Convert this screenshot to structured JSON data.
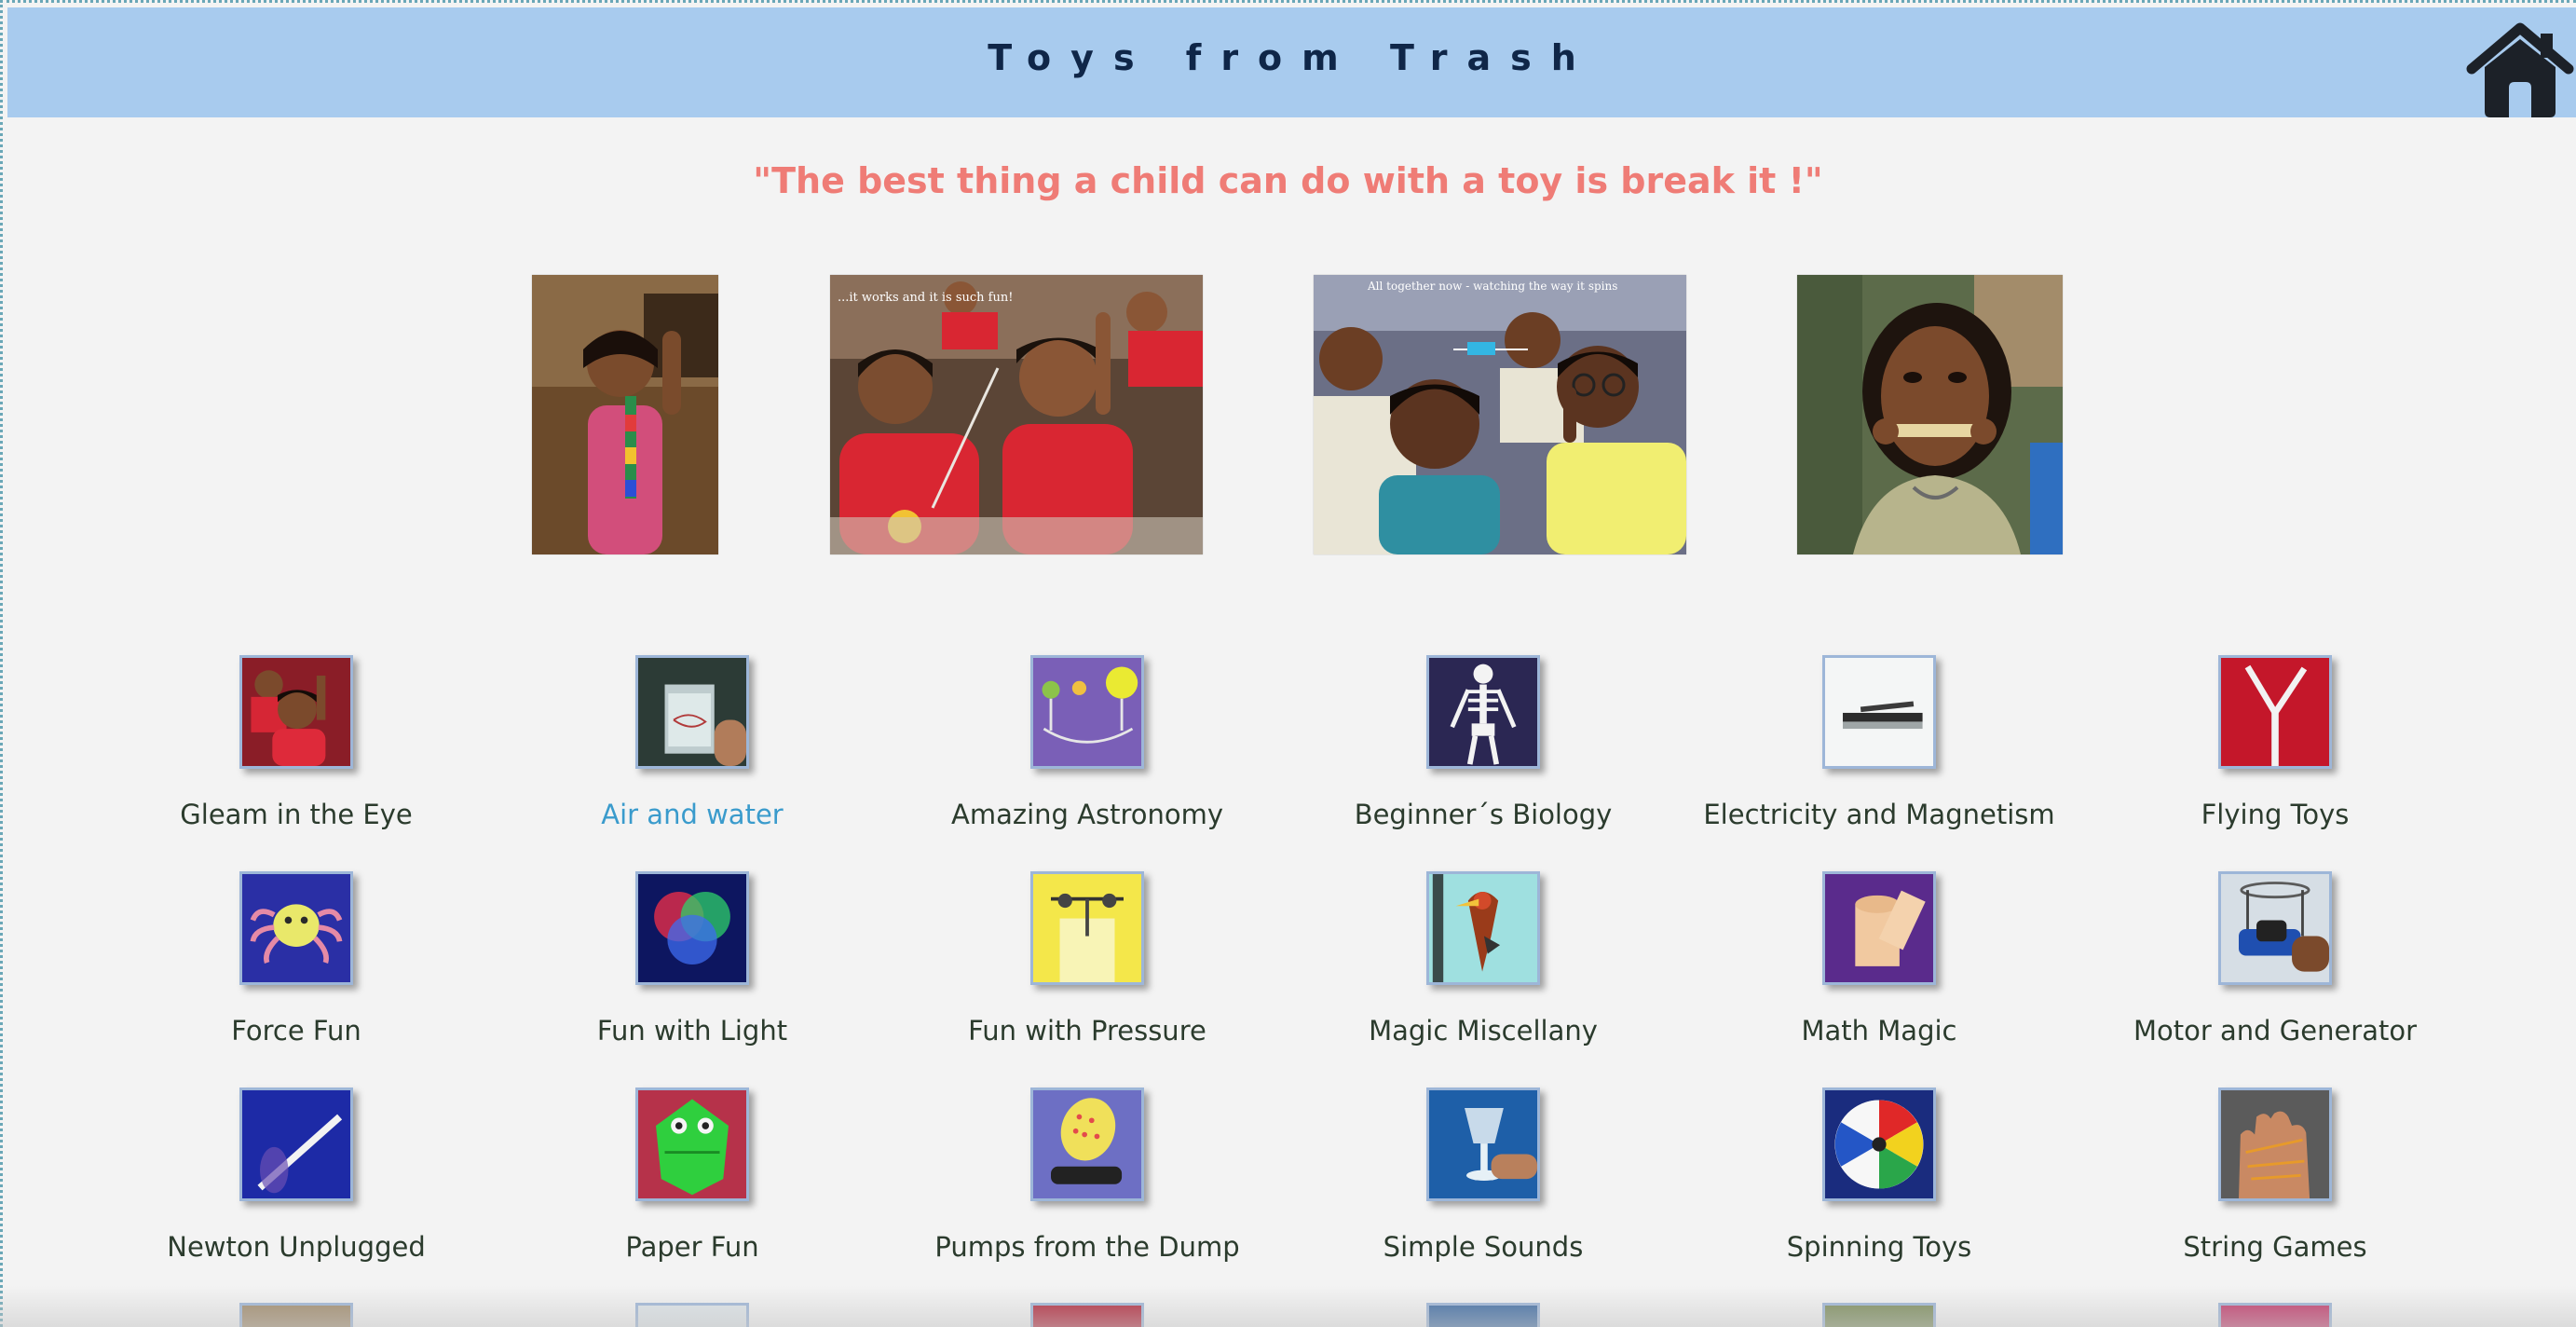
{
  "header": {
    "title": "Toys from Trash",
    "home_icon": "home-icon",
    "background": "#a8cbee"
  },
  "quote": "\"The best thing a child can do with a toy is break it !\"",
  "photos": [
    {
      "caption": ""
    },
    {
      "caption": "...it works and it is such fun!"
    },
    {
      "caption": "All together now - watching the way it spins"
    },
    {
      "caption": ""
    }
  ],
  "categories": [
    {
      "label": "Gleam in the Eye"
    },
    {
      "label": "Air and water",
      "active": true
    },
    {
      "label": "Amazing Astronomy"
    },
    {
      "label": "Beginner´s Biology"
    },
    {
      "label": "Electricity and Magnetism"
    },
    {
      "label": "Flying Toys"
    },
    {
      "label": "Force Fun"
    },
    {
      "label": "Fun with Light"
    },
    {
      "label": "Fun with Pressure"
    },
    {
      "label": "Magic Miscellany"
    },
    {
      "label": "Math Magic"
    },
    {
      "label": "Motor and Generator"
    },
    {
      "label": "Newton Unplugged"
    },
    {
      "label": "Paper Fun"
    },
    {
      "label": "Pumps from the Dump"
    },
    {
      "label": "Simple Sounds"
    },
    {
      "label": "Spinning Toys"
    },
    {
      "label": "String Games"
    }
  ],
  "colors": {
    "title": "#0f2648",
    "quote": "#ef7c76",
    "link": "#2b3b2d",
    "link_active": "#3a9bcc"
  }
}
